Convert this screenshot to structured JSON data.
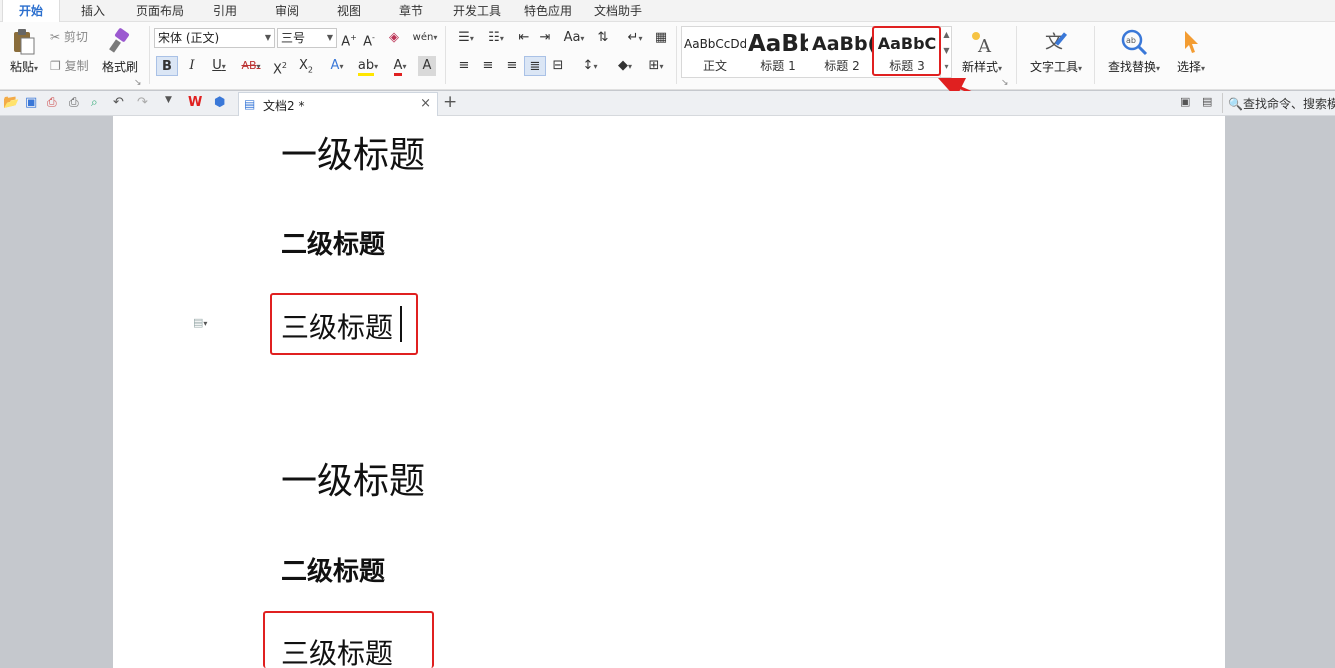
{
  "menu_tabs": [
    "开始",
    "插入",
    "页面布局",
    "引用",
    "审阅",
    "视图",
    "章节",
    "开发工具",
    "特色应用",
    "文档助手"
  ],
  "clipboard": {
    "paste": "粘贴",
    "cut": "剪切",
    "copy": "复制",
    "format_painter": "格式刷"
  },
  "font": {
    "family": "宋体 (正文)",
    "size": "三号"
  },
  "styles": [
    {
      "preview": "AaBbCcDd",
      "name": "正文"
    },
    {
      "preview": "AaBb",
      "name": "标题 1"
    },
    {
      "preview": "AaBb(",
      "name": "标题 2"
    },
    {
      "preview": "AaBbC",
      "name": "标题 3"
    }
  ],
  "tools": {
    "new_style": "新样式",
    "text_tools": "文字工具",
    "find_replace": "查找替换",
    "select": "选择"
  },
  "doc_tab": {
    "title": "文档2 *",
    "close": "×",
    "add": "+"
  },
  "search": {
    "placeholder": "查找命令、搜索模"
  },
  "document": {
    "h1_first": "一级标题",
    "h2_first": "二级标题",
    "h3_first": "三级标题",
    "h1_second": "一级标题",
    "h2_second": "二级标题",
    "h3_second": "三级标题"
  },
  "colors": {
    "active_tab": "#2b6fce",
    "annotation": "#e02020",
    "page": "#ffffff",
    "workspace": "#c5c8cd"
  }
}
